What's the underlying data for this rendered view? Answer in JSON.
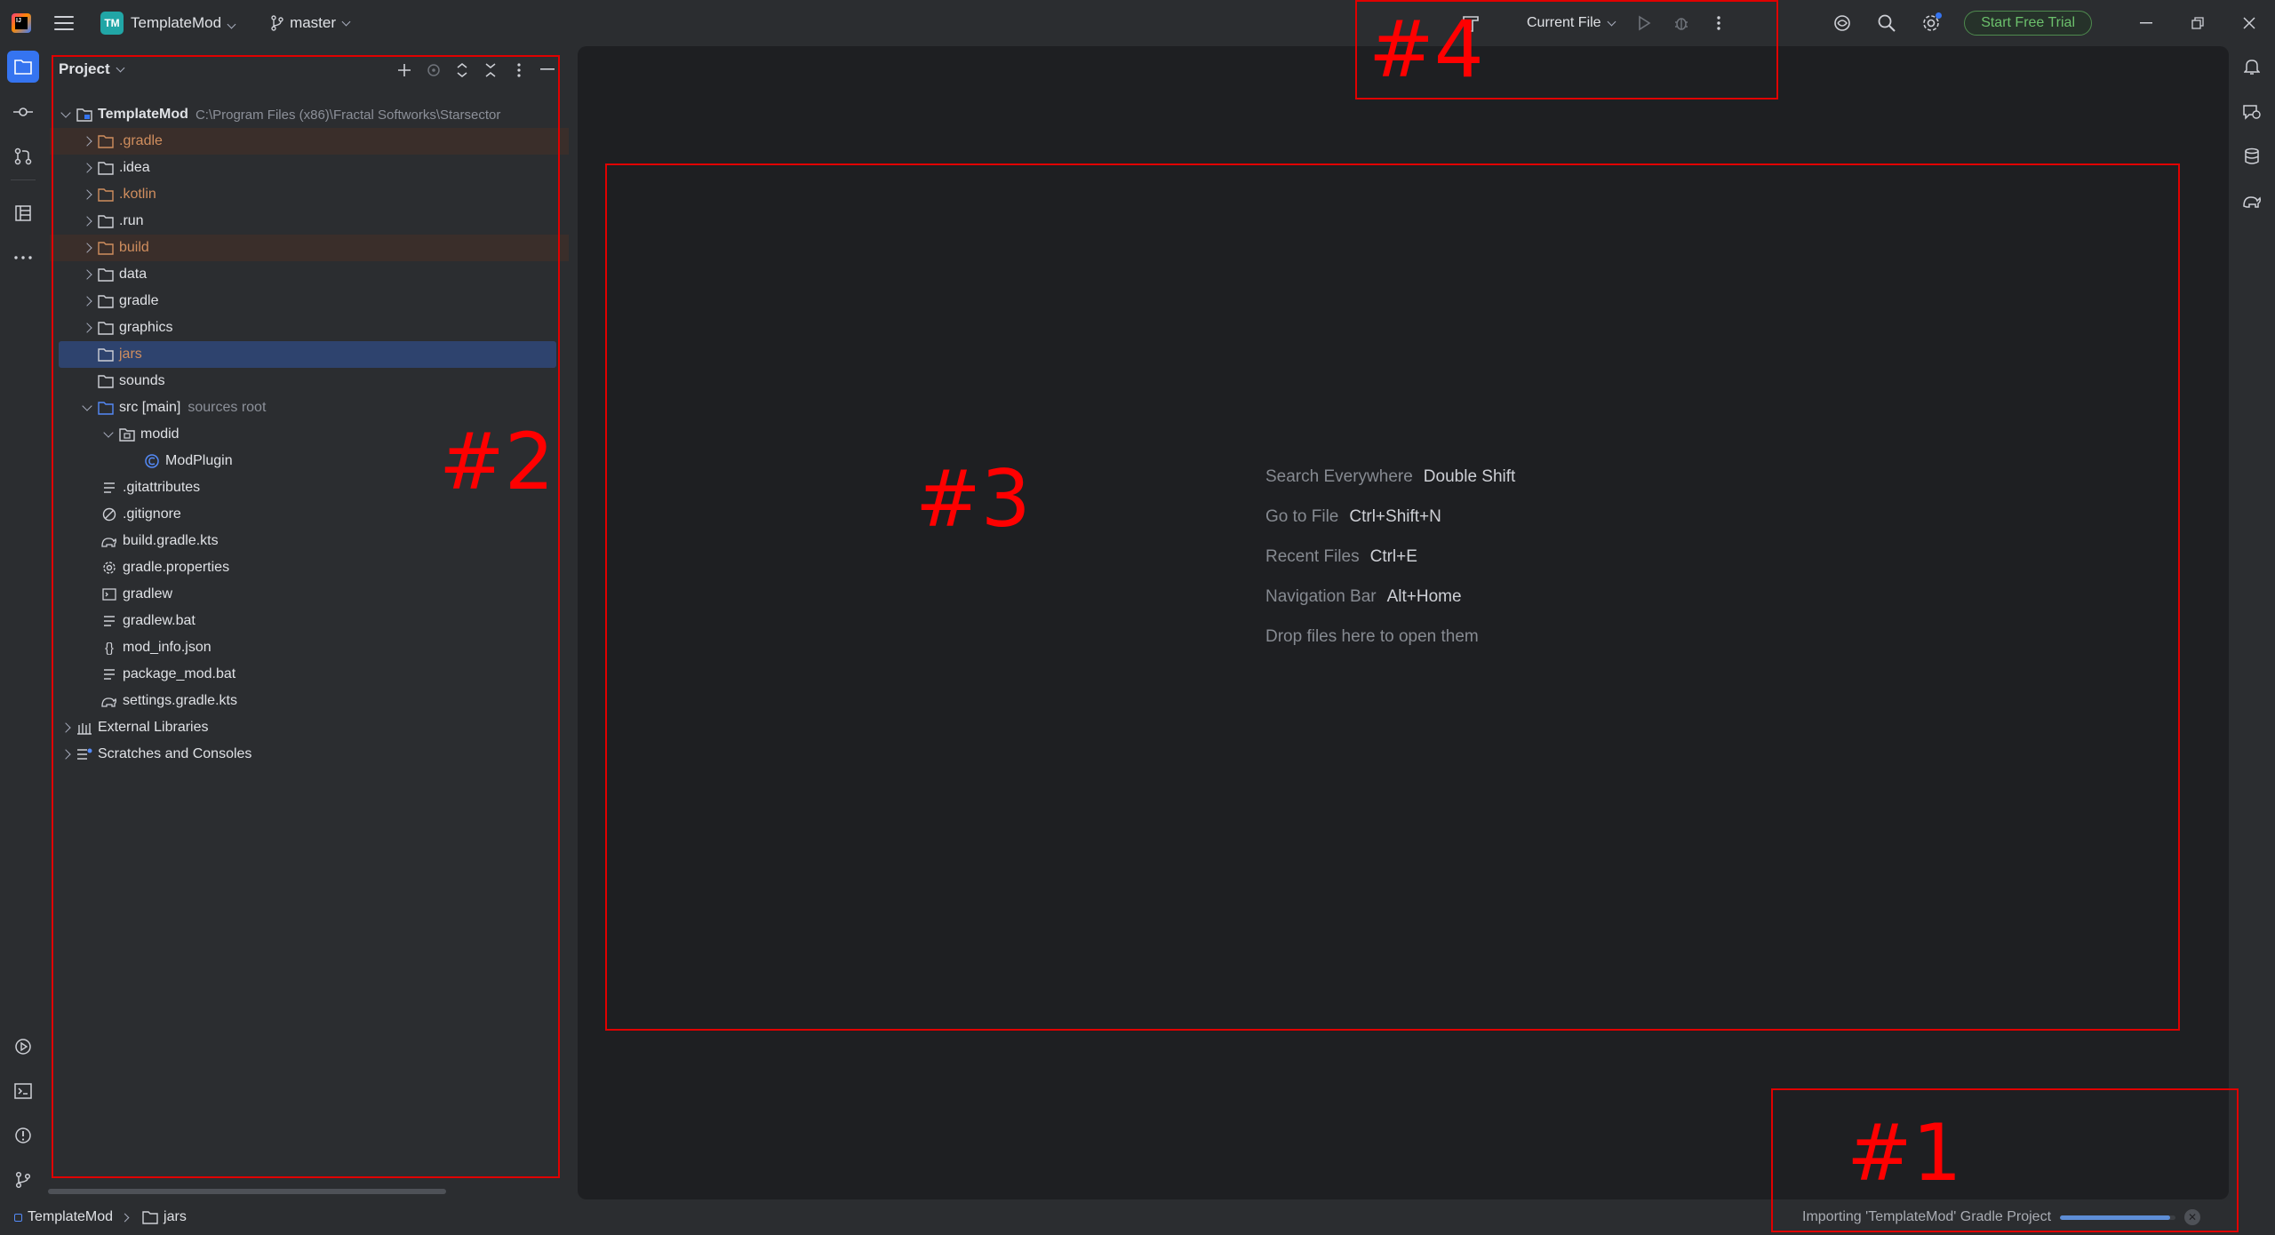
{
  "titlebar": {
    "project_badge": "TM",
    "project_name": "TemplateMod",
    "branch": "master",
    "run_config": "Current File",
    "trial_button": "Start Free Trial"
  },
  "project_panel": {
    "title": "Project",
    "tree": [
      {
        "label": "TemplateMod",
        "path": "C:\\Program Files (x86)\\Fractal Softworks\\Starsector",
        "kind": "module",
        "depth": 0,
        "expanded": true
      },
      {
        "label": ".gradle",
        "kind": "folder-excluded",
        "depth": 1
      },
      {
        "label": ".idea",
        "kind": "folder",
        "depth": 1
      },
      {
        "label": ".kotlin",
        "kind": "folder-excluded",
        "depth": 1
      },
      {
        "label": ".run",
        "kind": "folder",
        "depth": 1
      },
      {
        "label": "build",
        "kind": "folder-excluded",
        "depth": 1
      },
      {
        "label": "data",
        "kind": "folder",
        "depth": 1
      },
      {
        "label": "gradle",
        "kind": "folder",
        "depth": 1
      },
      {
        "label": "graphics",
        "kind": "folder",
        "depth": 1
      },
      {
        "label": "jars",
        "kind": "folder",
        "depth": 1,
        "selected": true
      },
      {
        "label": "sounds",
        "kind": "folder",
        "depth": 1
      },
      {
        "label": "src [main]",
        "suffix": "sources root",
        "kind": "src",
        "depth": 1,
        "expanded": true
      },
      {
        "label": "modid",
        "kind": "package",
        "depth": 2,
        "expanded": true
      },
      {
        "label": "ModPlugin",
        "kind": "class",
        "depth": 3
      },
      {
        "label": ".gitattributes",
        "kind": "text",
        "depth": 1
      },
      {
        "label": ".gitignore",
        "kind": "ignore",
        "depth": 1
      },
      {
        "label": "build.gradle.kts",
        "kind": "gradle",
        "depth": 1
      },
      {
        "label": "gradle.properties",
        "kind": "props",
        "depth": 1
      },
      {
        "label": "gradlew",
        "kind": "shell",
        "depth": 1
      },
      {
        "label": "gradlew.bat",
        "kind": "text",
        "depth": 1
      },
      {
        "label": "mod_info.json",
        "kind": "json",
        "depth": 1
      },
      {
        "label": "package_mod.bat",
        "kind": "text",
        "depth": 1
      },
      {
        "label": "settings.gradle.kts",
        "kind": "gradle",
        "depth": 1
      },
      {
        "label": "External Libraries",
        "kind": "libs",
        "depth": 0
      },
      {
        "label": "Scratches and Consoles",
        "kind": "scratches",
        "depth": 0
      }
    ]
  },
  "editor": {
    "hints": [
      {
        "label": "Search Everywhere",
        "shortcut": "Double Shift"
      },
      {
        "label": "Go to File",
        "shortcut": "Ctrl+Shift+N"
      },
      {
        "label": "Recent Files",
        "shortcut": "Ctrl+E"
      },
      {
        "label": "Navigation Bar",
        "shortcut": "Alt+Home"
      },
      {
        "label": "Drop files here to open them",
        "shortcut": ""
      }
    ]
  },
  "statusbar": {
    "crumbs": [
      "TemplateMod",
      "jars"
    ],
    "progress_text": "Importing 'TemplateMod' Gradle Project",
    "progress_value": 0.95
  },
  "annotations": {
    "a1": "#1",
    "a2": "#2",
    "a3": "#3",
    "a4": "#4"
  },
  "colors": {
    "accent": "#3574f0",
    "excluded_folder": "#d08e5e",
    "selection": "#2e436e",
    "annotation": "#ff0000"
  }
}
